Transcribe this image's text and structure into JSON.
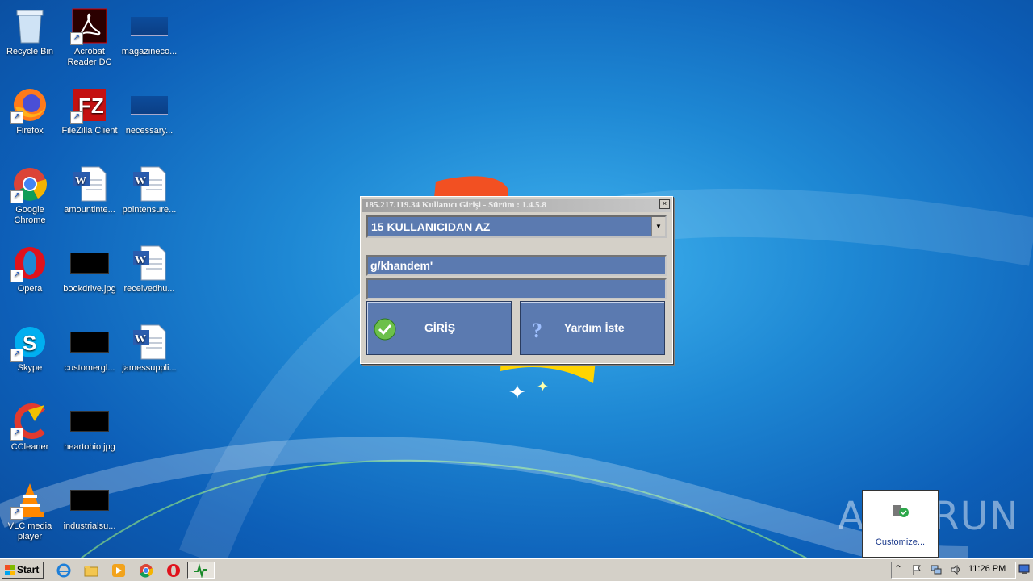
{
  "desktop": {
    "icons": [
      {
        "label": "Recycle Bin",
        "icon": "recycle-bin-icon"
      },
      {
        "label": "Acrobat\nReader DC",
        "icon": "acrobat-reader-icon"
      },
      {
        "label": "magazineco...",
        "icon": "image-thumbnail-icon"
      },
      {
        "label": "Firefox",
        "icon": "firefox-icon"
      },
      {
        "label": "FileZilla Client",
        "icon": "filezilla-icon"
      },
      {
        "label": "necessary...",
        "icon": "image-thumbnail-icon"
      },
      {
        "label": "Google\nChrome",
        "icon": "chrome-icon"
      },
      {
        "label": "amountinte...",
        "icon": "word-document-icon"
      },
      {
        "label": "pointensure...",
        "icon": "word-document-icon"
      },
      {
        "label": "Opera",
        "icon": "opera-icon"
      },
      {
        "label": "bookdrive.jpg",
        "icon": "jpg-thumbnail-icon"
      },
      {
        "label": "receivedhu...",
        "icon": "word-document-icon"
      },
      {
        "label": "Skype",
        "icon": "skype-icon"
      },
      {
        "label": "customergl...",
        "icon": "jpg-thumbnail-icon"
      },
      {
        "label": "jamessuppli...",
        "icon": "word-document-icon"
      },
      {
        "label": "CCleaner",
        "icon": "ccleaner-icon"
      },
      {
        "label": "heartohio.jpg",
        "icon": "jpg-thumbnail-icon"
      },
      {
        "label": "VLC media\nplayer",
        "icon": "vlc-icon"
      },
      {
        "label": "industrialsu...",
        "icon": "jpg-thumbnail-icon"
      }
    ]
  },
  "dialog": {
    "title": "185.217.119.34  Kullanıcı Girişi - Sürüm : 1.4.5.8",
    "close_label": "×",
    "combo_value": "15 KULLANICIDAN AZ",
    "username_value": "g/khandem'",
    "password_value": "",
    "login_label": "GİRİŞ",
    "help_label": "Yardım İste"
  },
  "taskbar": {
    "start_label": "Start",
    "clock": "11:26 PM",
    "tray_popup_label": "Customize..."
  },
  "watermark": "ANY  RUN",
  "colors": {
    "dialog_field": "#5b7ab0",
    "taskbar": "#d4d0c8",
    "desktop_blue": "#1e88d4"
  }
}
